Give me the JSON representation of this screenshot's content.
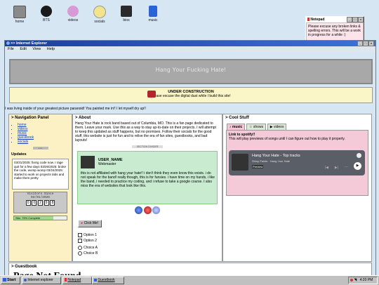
{
  "desktop": {
    "icons": [
      {
        "label": "home",
        "color": "#8a8a8a"
      },
      {
        "label": "BTS",
        "color": "#1a1a1a"
      },
      {
        "label": "videos",
        "color": "#d89ad6"
      },
      {
        "label": "socials",
        "color": "#f3e38b"
      },
      {
        "label": "bios",
        "color": "#2a2a2a"
      },
      {
        "label": "music",
        "color": "#2a63d8"
      }
    ]
  },
  "notepad": {
    "title": "Notepad",
    "text": "Please excuse any broken links & spelling errors. This will be a work in progress for a while :)"
  },
  "browser": {
    "title": ">> Internet Explorer",
    "menu": [
      "File",
      "Edit",
      "View",
      "Help"
    ]
  },
  "banner": {
    "title": "Hang Your Fucking Hate!"
  },
  "construction": {
    "title": "UNDER CONSTRUCTION",
    "text": "Please excuse the digital dust while I build this site!"
  },
  "quote": "I was living inside of your greatest picture paranoid! You painted me in!! I let myself dry up!!",
  "nav": {
    "title": "> Navigation Panel",
    "links": [
      "home",
      "videos",
      "music",
      "guestbook",
      "socials"
    ]
  },
  "updates": {
    "title": "Updates",
    "text": "03/31/2025: fixing code now. I rage quit for a few days 03/26/2025: broke the code, womp womp 03/24/2025: started to work on projects tabs and make them pretty"
  },
  "counter": {
    "label": "Visitors Since",
    "date": "03/01/2025",
    "digits": [
      "0",
      "0",
      "2",
      "9",
      "8"
    ]
  },
  "progress": {
    "value": 0.75,
    "label": "Site: 75% Complete"
  },
  "about": {
    "title": "> About",
    "text": "Hang Your Hate is rock band based out of Columbia, MO. This is a fan page dedicated to them. Leave your mark. Use this as a way to stay up-to-date on their projects. I will attempt to keep this updated as stuff happens, but no promises. Follow their socials for the good stuff, this website is just for fun and to relive the era of fan sites, guestbooks, and bad layouts!",
    "section_divider": "SECTION DIVIDER",
    "card": {
      "name": "USER_NAME",
      "role": "Webmaster",
      "text": "this is not affiliated with hang your hate!! i don't think they even know this exists. i do not speak for the band! really though, this is for funsies. i have time on my hands, i like the band, i needed to practice my coding, and i refuse to take a google course. I also miss the era of websites that look like this."
    },
    "click_button": "Click Me!",
    "options": [
      "Option 1",
      "Option 2"
    ],
    "choices": [
      "Choice A",
      "Choice B"
    ]
  },
  "cool": {
    "title": "> Cool Stuff",
    "tabs": [
      "music",
      "shows",
      "videos"
    ],
    "spotify_title": "Link to spotify!!",
    "spotify_text": "This will play previews of songs until I can figure out how to play it properly.",
    "player": {
      "title": "Hang Your Hate - Top tracks",
      "subtitle": "Shiny Paints · Hang Your Hate",
      "badge": "Preview"
    }
  },
  "guestbook": {
    "title": "> Guestbook",
    "page_text": "Page Not Found"
  },
  "taskbar": {
    "start": "Start",
    "items": [
      "Internet explorer",
      "Notepad",
      "Guestbook"
    ],
    "clock": "4:20 PM"
  }
}
